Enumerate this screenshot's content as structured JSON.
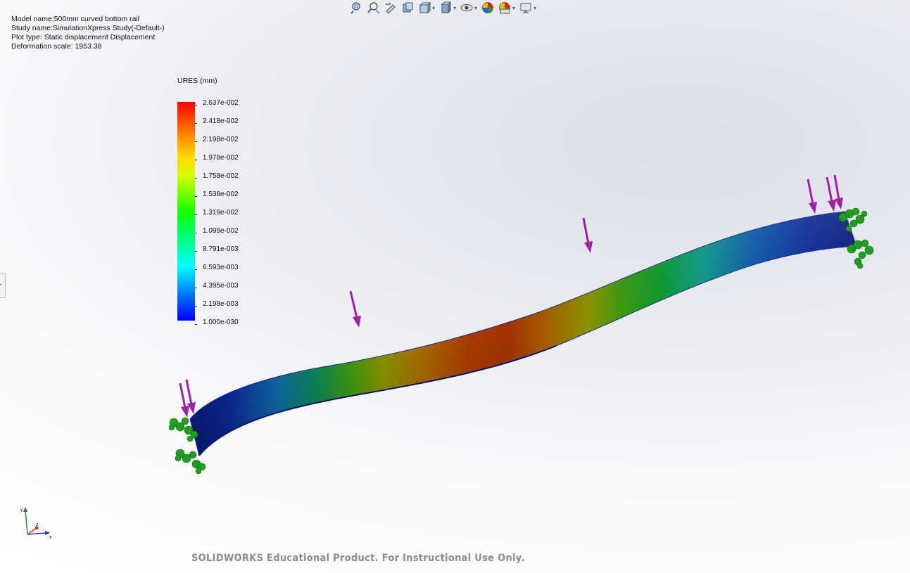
{
  "toolbar": {
    "buttons": [
      {
        "icon": "zoom-to-fit-icon",
        "has_dropdown": false
      },
      {
        "icon": "zoom-to-area-icon",
        "has_dropdown": false
      },
      {
        "icon": "previous-view-icon",
        "has_dropdown": false
      },
      {
        "icon": "section-view-icon",
        "has_dropdown": false
      },
      {
        "icon": "view-orientation-icon",
        "has_dropdown": true
      },
      {
        "icon": "display-style-icon",
        "has_dropdown": true
      },
      {
        "icon": "hide-show-items-icon",
        "has_dropdown": true
      },
      {
        "icon": "edit-appearance-icon",
        "has_dropdown": false
      },
      {
        "icon": "apply-scene-icon",
        "has_dropdown": true
      },
      {
        "icon": "view-settings-icon",
        "has_dropdown": true
      }
    ]
  },
  "info": {
    "model_name": "Model name:500mm curved bottom rail",
    "study_name": "Study name:SimulationXpress Study(-Default-)",
    "plot_type": "Plot type: Static displacement Displacement",
    "deformation_scale": "Deformation scale: 1953.38"
  },
  "legend": {
    "title": "URES (mm)",
    "labels": [
      "2.637e-002",
      "2.418e-002",
      "2.198e-002",
      "1.978e-002",
      "1.758e-002",
      "1.538e-002",
      "1.319e-002",
      "1.099e-002",
      "8.791e-003",
      "6.593e-003",
      "4.395e-003",
      "2.198e-003",
      "1.000e-030"
    ]
  },
  "triad": {
    "x_label": "x",
    "y_label": "y",
    "z_label": "z"
  },
  "colors": {
    "load_arrow": "#a020a8",
    "fixture": "#1f9e1f",
    "max_displacement": "#ff0000",
    "min_displacement": "#0000ff"
  },
  "watermark": "SOLIDWORKS Educational Product. For Instructional Use Only."
}
